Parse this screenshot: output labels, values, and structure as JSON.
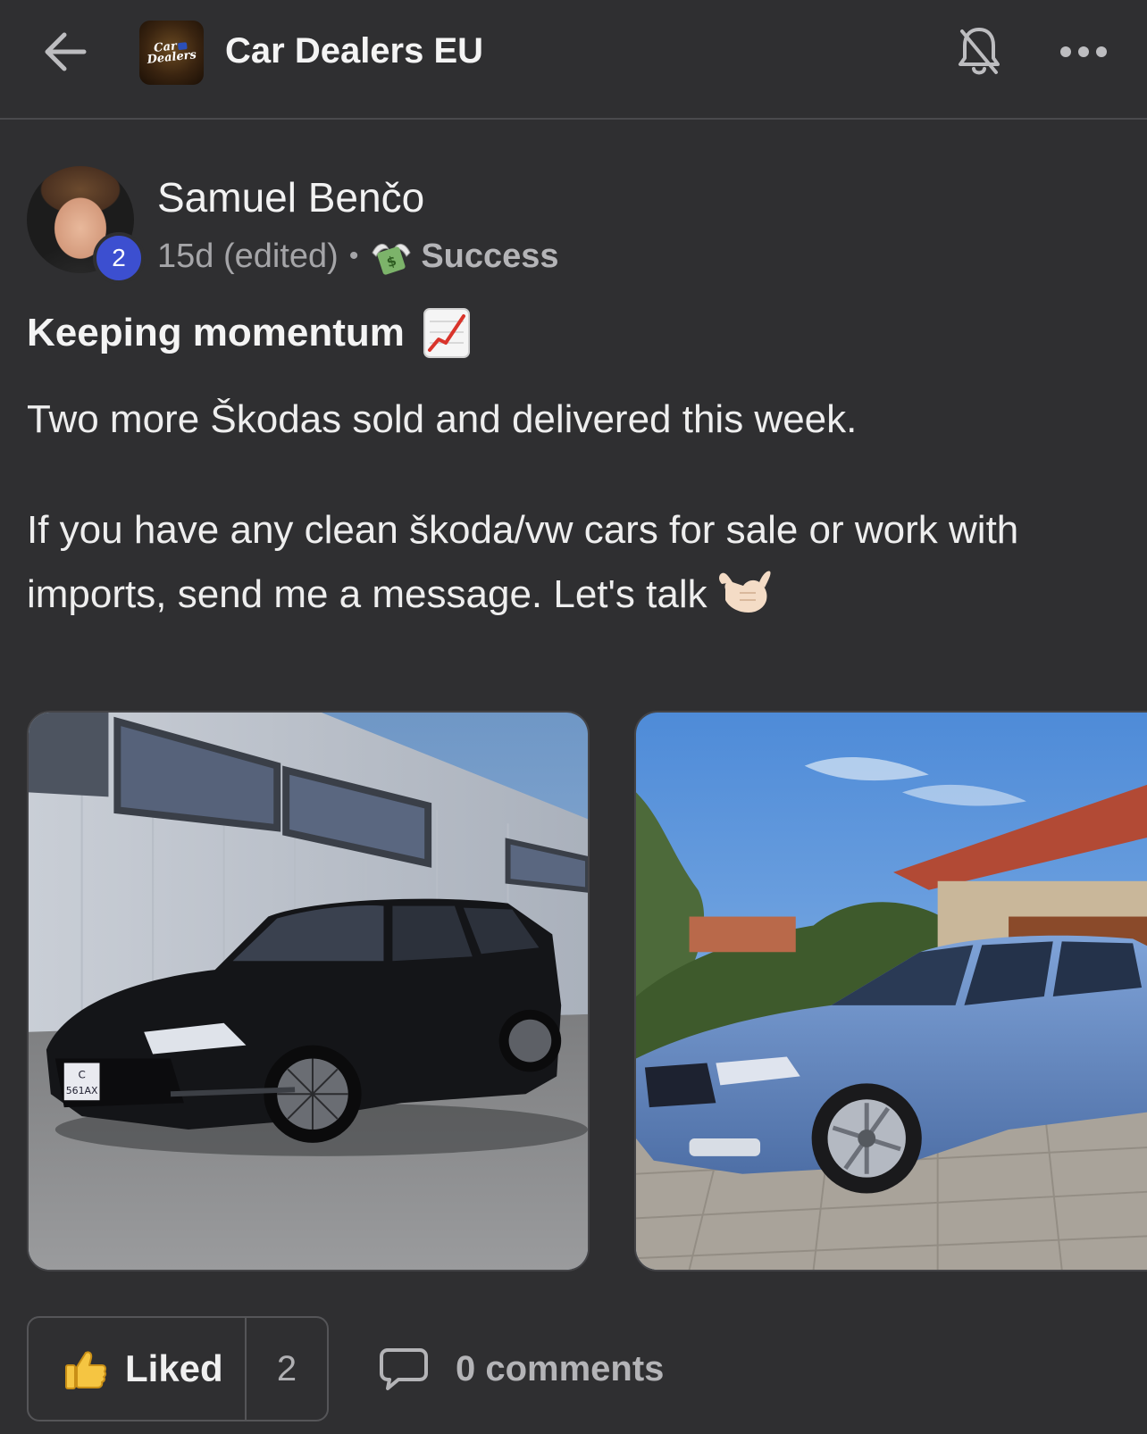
{
  "header": {
    "back_icon": "arrow-left-icon",
    "group_logo_text_line1": "Car",
    "group_logo_text_line2": "Dealers",
    "group_title": "Car Dealers EU",
    "bell_icon": "bell-off-icon",
    "more_icon": "ellipsis-icon"
  },
  "post": {
    "author": {
      "name": "Samuel Benčo",
      "level": "2"
    },
    "meta": {
      "time": "15d (edited)",
      "separator": "•",
      "category_icon": "money-with-wings-icon",
      "category": "Success"
    },
    "title": "Keeping momentum",
    "title_emoji": "chart-increasing-icon",
    "paragraph1": "Two more Škodas sold and delivered this week.",
    "paragraph2": "If you have any clean škoda/vw cars for sale or work with imports, send me a message. Let's talk",
    "paragraph2_emoji": "call-me-hand-icon",
    "images": [
      {
        "label": "black-skoda-superb-wagon"
      },
      {
        "label": "blue-skoda-octavia-wagon"
      }
    ],
    "plate_text_line1": "C",
    "plate_text_line2": "561AX"
  },
  "actions": {
    "like_label": "Liked",
    "like_count": "2",
    "comments_label": "0 comments"
  },
  "colors": {
    "background": "#2f2f31",
    "badge": "#3c4fd0",
    "text": "#f2f2f2",
    "muted": "#a5a5a8"
  }
}
